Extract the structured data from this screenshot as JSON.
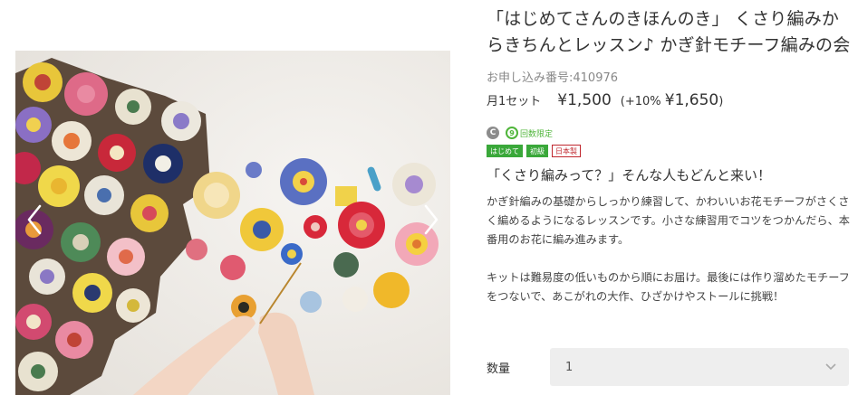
{
  "product": {
    "title": "「はじめてさんのきほんのき」 くさり編みからきちんとレッスン♪ かぎ針モチーフ編みの会",
    "order_number": "お申し込み番号:410976",
    "price_label": "月1セット",
    "price": "¥1,500",
    "price_tax_prefix": "(+10% ",
    "price_tax_amount": "¥1,650",
    "price_tax_suffix": ")",
    "icons": {
      "payment_icon": "C",
      "limit_icon": "9",
      "limit_label": "回数限定"
    },
    "tags": [
      {
        "label": "はじめて",
        "color": "#3aa83a"
      },
      {
        "label": "初級",
        "color": "#3aa83a"
      },
      {
        "label": "日本製",
        "color": "#c0262d"
      }
    ],
    "catchphrase": "「くさり編みって？」そんな人もどんと来い！",
    "description": [
      "かぎ針編みの基礎からしっかり練習して、かわいいお花モチーフがさくさく編めるようになるレッスンです。小さな練習用でコツをつかんだら、本番用のお花に編み進みます。",
      "キットは難易度の低いものから順にお届け。最後には作り溜めたモチーフをつないで、あこがれの大作、ひざかけやストールに挑戦！"
    ]
  },
  "quantity": {
    "label": "数量",
    "selected": "1"
  },
  "gallery": {
    "prev_icon": "chevron-left-icon",
    "next_icon": "chevron-right-icon"
  },
  "colors": {
    "accent_green": "#3aa83a",
    "tag_red": "#c0262d"
  }
}
